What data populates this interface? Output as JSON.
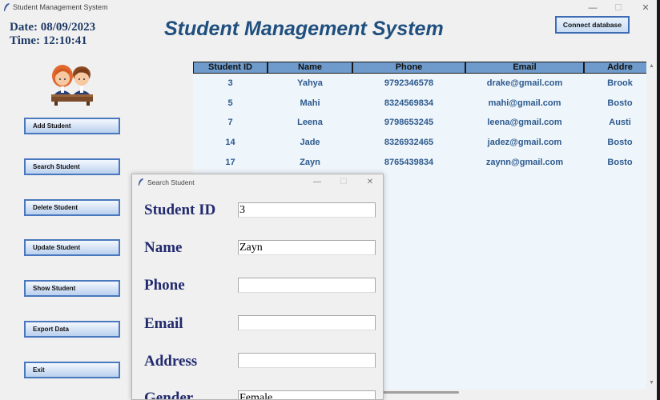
{
  "window": {
    "title": "Student Management System"
  },
  "header": {
    "date": "Date: 08/09/2023",
    "time": "Time: 12:10:41",
    "app_title": "Student Management System",
    "connect_label": "Connect database"
  },
  "sidebar": {
    "buttons": [
      "Add Student",
      "Search Student",
      "Delete Student",
      "Update Student",
      "Show Student",
      "Export Data",
      "Exit"
    ]
  },
  "table": {
    "columns": [
      "Student ID",
      "Name",
      "Phone",
      "Email",
      "Addre"
    ],
    "rows": [
      [
        "3",
        "Yahya",
        "9792346578",
        "drake@gmail.com",
        "Brook"
      ],
      [
        "5",
        "Mahi",
        "8324569834",
        "mahi@gmail.com",
        "Bosto"
      ],
      [
        "7",
        "Leena",
        "9798653245",
        "leena@gmail.com",
        "Austi"
      ],
      [
        "14",
        "Jade",
        "8326932465",
        "jadez@gmail.com",
        "Bosto"
      ],
      [
        "17",
        "Zayn",
        "8765439834",
        "zaynn@gmail.com",
        "Bosto"
      ]
    ]
  },
  "dialog": {
    "title": "Search Student",
    "fields": [
      {
        "label": "Student ID",
        "value": "3"
      },
      {
        "label": "Name",
        "value": "Zayn"
      },
      {
        "label": "Phone",
        "value": ""
      },
      {
        "label": "Email",
        "value": ""
      },
      {
        "label": "Address",
        "value": ""
      },
      {
        "label": "Gender",
        "value": "Female"
      }
    ]
  },
  "colors": {
    "title_blue": "#1e4f7e",
    "header_bg": "#6e9bcb",
    "cell_text": "#2d5a8e",
    "label_navy": "#222a6e"
  }
}
